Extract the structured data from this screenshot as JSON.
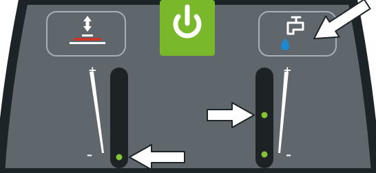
{
  "panel": {
    "colors": {
      "body": "#5f676c",
      "edge": "#1c2428",
      "button_outline": "#aab0b3",
      "power_button": "#78b82a",
      "slot": "#1d2225",
      "led_on": "#86c332",
      "accent_red": "#c8332a",
      "water_drop": "#1e88d4",
      "arrow": "#ffffff"
    },
    "buttons": [
      {
        "id": "brush-pressure",
        "icon": "brush-pressure-icon"
      },
      {
        "id": "power",
        "icon": "power-icon"
      },
      {
        "id": "water-flow",
        "icon": "faucet-icon"
      }
    ],
    "brush_pressure_scale": {
      "max_label": "+",
      "min_label": "–",
      "level": "minimum",
      "lit_led": "bottom"
    },
    "water_flow_scale": {
      "max_label": "+",
      "min_label": "–",
      "level": "medium",
      "lit_led": "middle"
    },
    "pointer_arrows": [
      {
        "points_to": "water-flow-button"
      },
      {
        "points_to": "water-flow-middle-led"
      },
      {
        "points_to": "brush-pressure-bottom-led"
      }
    ]
  }
}
